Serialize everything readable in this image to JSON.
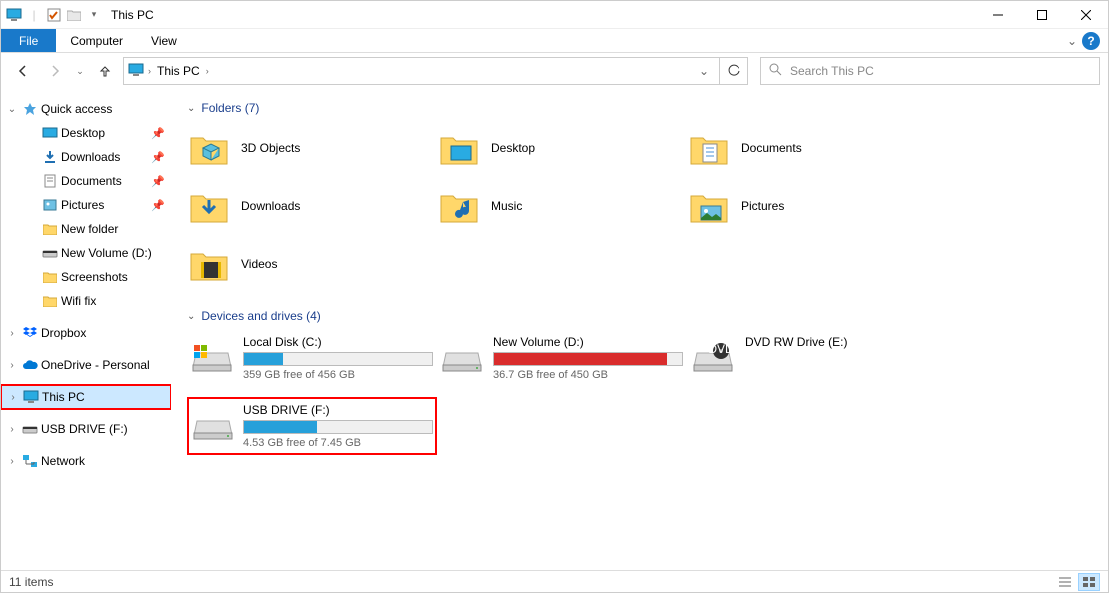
{
  "window": {
    "title": "This PC"
  },
  "ribbon": {
    "file": "File",
    "tabs": [
      "Computer",
      "View"
    ]
  },
  "nav": {
    "breadcrumb": "This PC",
    "search_placeholder": "Search This PC"
  },
  "tree": {
    "quick_access": "Quick access",
    "qa_items": [
      {
        "label": "Desktop",
        "pinned": true
      },
      {
        "label": "Downloads",
        "pinned": true
      },
      {
        "label": "Documents",
        "pinned": true
      },
      {
        "label": "Pictures",
        "pinned": true
      },
      {
        "label": "New folder",
        "pinned": false
      },
      {
        "label": "New Volume (D:)",
        "pinned": false
      },
      {
        "label": "Screenshots",
        "pinned": false
      },
      {
        "label": "Wifi fix",
        "pinned": false
      }
    ],
    "dropbox": "Dropbox",
    "onedrive": "OneDrive - Personal",
    "this_pc": "This PC",
    "usb": "USB DRIVE (F:)",
    "network": "Network"
  },
  "sections": {
    "folders_header": "Folders (7)",
    "folders": [
      "3D Objects",
      "Desktop",
      "Documents",
      "Downloads",
      "Music",
      "Pictures",
      "Videos"
    ],
    "drives_header": "Devices and drives (4)",
    "drives": [
      {
        "label": "Local Disk (C:)",
        "free": "359 GB free of 456 GB",
        "pct": 21,
        "color": "blue"
      },
      {
        "label": "New Volume (D:)",
        "free": "36.7 GB free of 450 GB",
        "pct": 92,
        "color": "red"
      },
      {
        "label": "DVD RW Drive (E:)",
        "nobar": true
      },
      {
        "label": "USB DRIVE (F:)",
        "free": "4.53 GB free of 7.45 GB",
        "pct": 39,
        "color": "blue",
        "highlighted": true
      }
    ]
  },
  "status": {
    "items": "11 items"
  }
}
